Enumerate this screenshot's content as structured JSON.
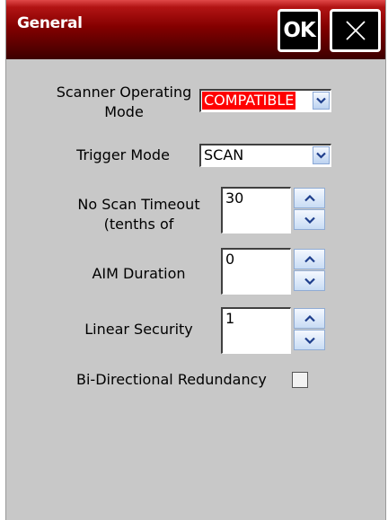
{
  "window": {
    "title": "General",
    "ok_label": "OK",
    "close_icon": "close-icon"
  },
  "form": {
    "scanner_operating_mode": {
      "label_line1": "Scanner Operating",
      "label_line2": "Mode",
      "value": "COMPATIBLE"
    },
    "trigger_mode": {
      "label": "Trigger Mode",
      "value": "SCAN"
    },
    "no_scan_timeout": {
      "label_line1": "No Scan Timeout",
      "label_line2": "(tenths of",
      "value": "30"
    },
    "aim_duration": {
      "label": "AIM Duration",
      "value": "0"
    },
    "linear_security": {
      "label": "Linear Security",
      "value": "1"
    },
    "bi_directional_redundancy": {
      "label": "Bi-Directional Redundancy",
      "checked": false
    }
  },
  "colors": {
    "titlebar_dark": "#3c0000",
    "titlebar_red": "#b21414",
    "panel_bg": "#c8c8c8",
    "selection_bg": "#ff0000",
    "arrow": "#1e3e8c"
  },
  "icons": {
    "dropdown": "chevron-down-icon",
    "spin_up": "chevron-up-icon",
    "spin_down": "chevron-down-icon"
  }
}
